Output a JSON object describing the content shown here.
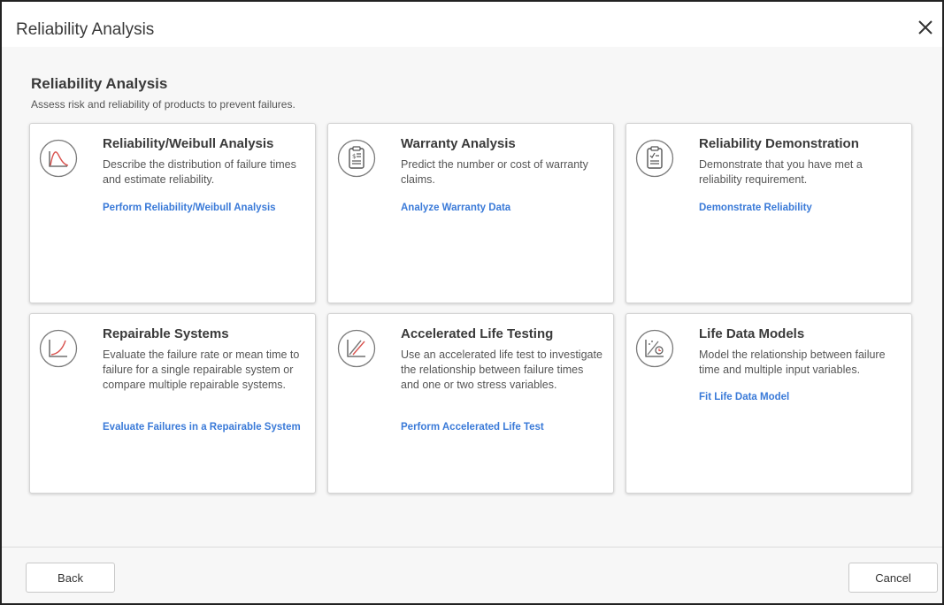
{
  "window": {
    "title": "Reliability Analysis"
  },
  "main": {
    "heading": "Reliability Analysis",
    "subheading": "Assess risk and reliability of products to prevent failures."
  },
  "cards": [
    {
      "title": "Reliability/Weibull Analysis",
      "description": "Describe the distribution of failure times and estimate reliability.",
      "link": "Perform Reliability/Weibull Analysis",
      "icon": "distribution-curve-icon"
    },
    {
      "title": "Warranty Analysis",
      "description": "Predict the number or cost of warranty claims.",
      "link": "Analyze Warranty Data",
      "icon": "warranty-clipboard-icon"
    },
    {
      "title": "Reliability Demonstration",
      "description": "Demonstrate that you have met a reliability requirement.",
      "link": "Demonstrate Reliability",
      "icon": "checklist-clipboard-icon"
    },
    {
      "title": "Repairable Systems",
      "description": "Evaluate the failure rate or mean time to failure for a single repairable system or compare multiple repairable systems.",
      "link": "Evaluate Failures in a Repairable System",
      "icon": "growth-curve-icon"
    },
    {
      "title": "Accelerated Life Testing",
      "description": "Use an accelerated life test to investigate the relationship between failure times and one or two stress variables.",
      "link": "Perform Accelerated Life Test",
      "icon": "parallel-lines-icon"
    },
    {
      "title": "Life Data Models",
      "description": "Model the relationship between failure time and multiple input variables.",
      "link": "Fit Life Data Model",
      "icon": "life-data-model-icon"
    }
  ],
  "footer": {
    "back_label": "Back",
    "cancel_label": "Cancel"
  },
  "colors": {
    "link": "#3a7ad8",
    "accent_red": "#d9534f",
    "icon_gray": "#707070"
  }
}
